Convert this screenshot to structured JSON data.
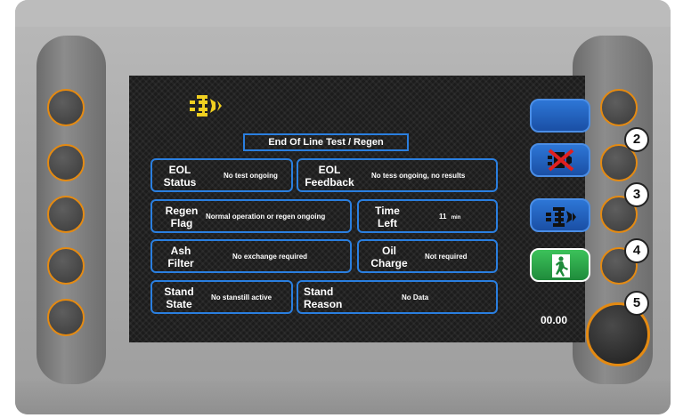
{
  "screen": {
    "title": "End Of Line Test / Regen",
    "time_readout": "00.00",
    "fields": {
      "eol_status": {
        "label_line1": "EOL",
        "label_line2": "Status",
        "value": "No test ongoing"
      },
      "eol_feedback": {
        "label_line1": "EOL",
        "label_line2": "Feedback",
        "value": "No tess ongoing, no results"
      },
      "regen_flag": {
        "label_line1": "Regen",
        "label_line2": "Flag",
        "value": "Normal operation or regen ongoing"
      },
      "time_left": {
        "label_line1": "Time",
        "label_line2": "Left",
        "value": "11",
        "unit": "min"
      },
      "ash_filter": {
        "label_line1": "Ash",
        "label_line2": "Filter",
        "value": "No exchange required"
      },
      "oil_charge": {
        "label_line1": "Oil",
        "label_line2": "Charge",
        "value": "Not required"
      },
      "stand_state": {
        "label_line1": "Stand",
        "label_line2": "State",
        "value": "No stanstill active"
      },
      "stand_reason": {
        "label_line1": "Stand",
        "label_line2": "Reason",
        "value": "No Data"
      }
    }
  },
  "side_buttons": [
    {
      "icon": "blank-blue-button",
      "color": "#1f5fbf"
    },
    {
      "icon": "engine-crossed-icon",
      "color": "#1f5fbf"
    },
    {
      "icon": "engine-icon",
      "color": "#1f5fbf"
    },
    {
      "icon": "exit-icon",
      "color": "#2ea84a"
    }
  ],
  "callouts": [
    "2",
    "3",
    "4",
    "5"
  ],
  "colors": {
    "accent_border": "#2a7fe0",
    "logo": "#f0d020",
    "hardware_ring": "#e48a12"
  }
}
